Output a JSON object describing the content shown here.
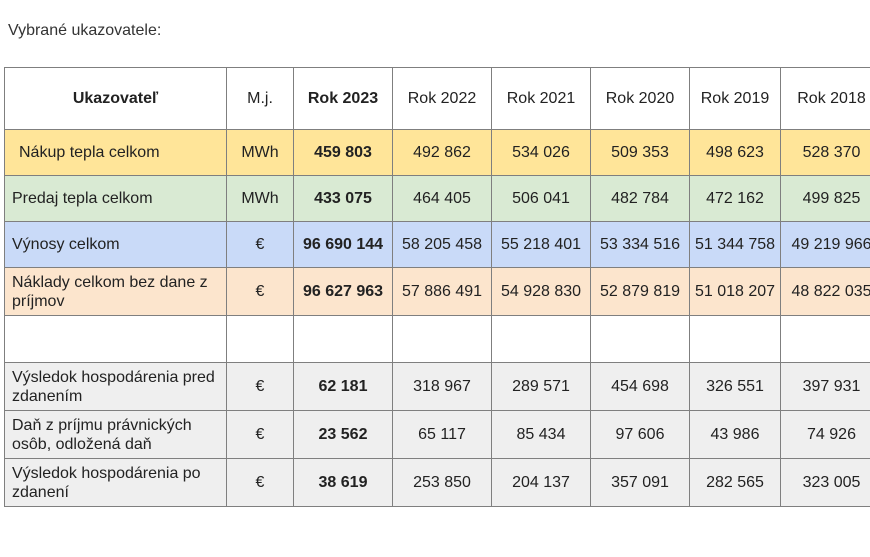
{
  "caption": "Vybrané ukazovatele:",
  "table": {
    "headers": [
      "Ukazovateľ",
      "M.j.",
      "Rok 2023",
      "Rok 2022",
      "Rok 2021",
      "Rok 2020",
      "Rok 2019",
      "Rok 2018"
    ],
    "rows": [
      {
        "label": "Nákup tepla celkom",
        "unit": "MWh",
        "values": [
          "459 803",
          "492 862",
          "534 026",
          "509 353",
          "498 623",
          "528 370"
        ],
        "color": "#ffe599"
      },
      {
        "label": "Predaj tepla celkom",
        "unit": "MWh",
        "values": [
          "433 075",
          "464 405",
          "506 041",
          "482 784",
          "472 162",
          "499 825"
        ],
        "color": "#d9ead3"
      },
      {
        "label": "Výnosy celkom",
        "unit": "€",
        "values": [
          "96 690 144",
          "58 205 458",
          "55 218 401",
          "53 334 516",
          "51 344 758",
          "49 219 966"
        ],
        "color": "#c9daf8"
      },
      {
        "label": "Náklady celkom bez dane z príjmov",
        "unit": "€",
        "values": [
          "96 627 963",
          "57 886 491",
          "54 928 830",
          "52 879 819",
          "51 018 207",
          "48 822 035"
        ],
        "color": "#fce5cd"
      },
      {
        "label": "",
        "unit": "",
        "values": [
          "",
          "",
          "",
          "",
          "",
          ""
        ],
        "color": "#ffffff"
      },
      {
        "label": "Výsledok hospodárenia pred zdanením",
        "unit": "€",
        "values": [
          "62 181",
          "318 967",
          "289 571",
          "454 698",
          "326 551",
          "397 931"
        ],
        "color": "#efefef"
      },
      {
        "label": "Daň z príjmu právnických osôb, odložená daň",
        "unit": "€",
        "values": [
          "23 562",
          "65 117",
          "85 434",
          "97 606",
          "43 986",
          "74 926"
        ],
        "color": "#efefef"
      },
      {
        "label": "Výsledok hospodárenia po zdanení",
        "unit": "€",
        "values": [
          "38 619",
          "253 850",
          "204 137",
          "357 091",
          "282 565",
          "323 005"
        ],
        "color": "#efefef"
      }
    ]
  }
}
